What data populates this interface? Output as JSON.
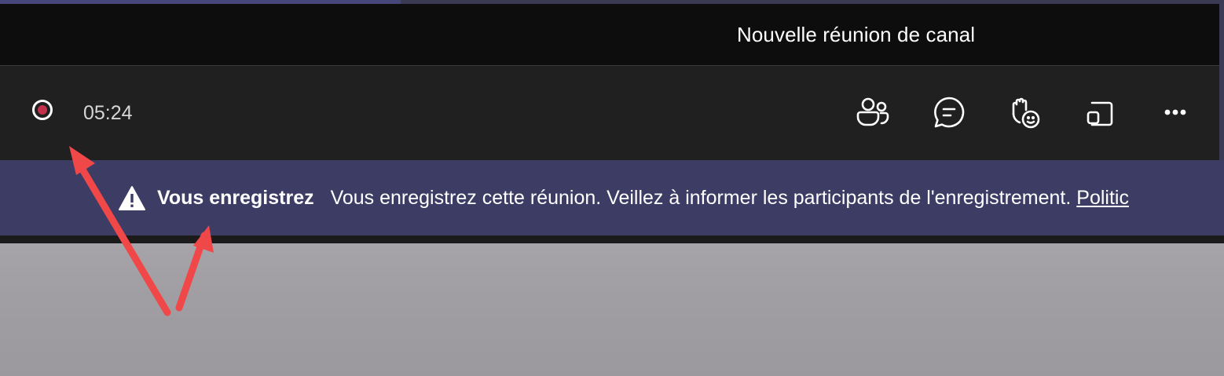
{
  "window": {
    "title": "Nouvelle réunion de canal"
  },
  "toolbar": {
    "timer": "05:24",
    "recording_color": "#c4314b",
    "icons": [
      "participants-icon",
      "chat-icon",
      "reactions-icon",
      "share-screen-icon",
      "more-icon"
    ]
  },
  "banner": {
    "heading": "Vous enregistrez",
    "message": "Vous enregistrez cette réunion. Veillez à informer les participants de l'enregistrement.",
    "link": "Politic",
    "background": "#3d3c64"
  },
  "annotation": {
    "arrow_color": "#f04848"
  }
}
